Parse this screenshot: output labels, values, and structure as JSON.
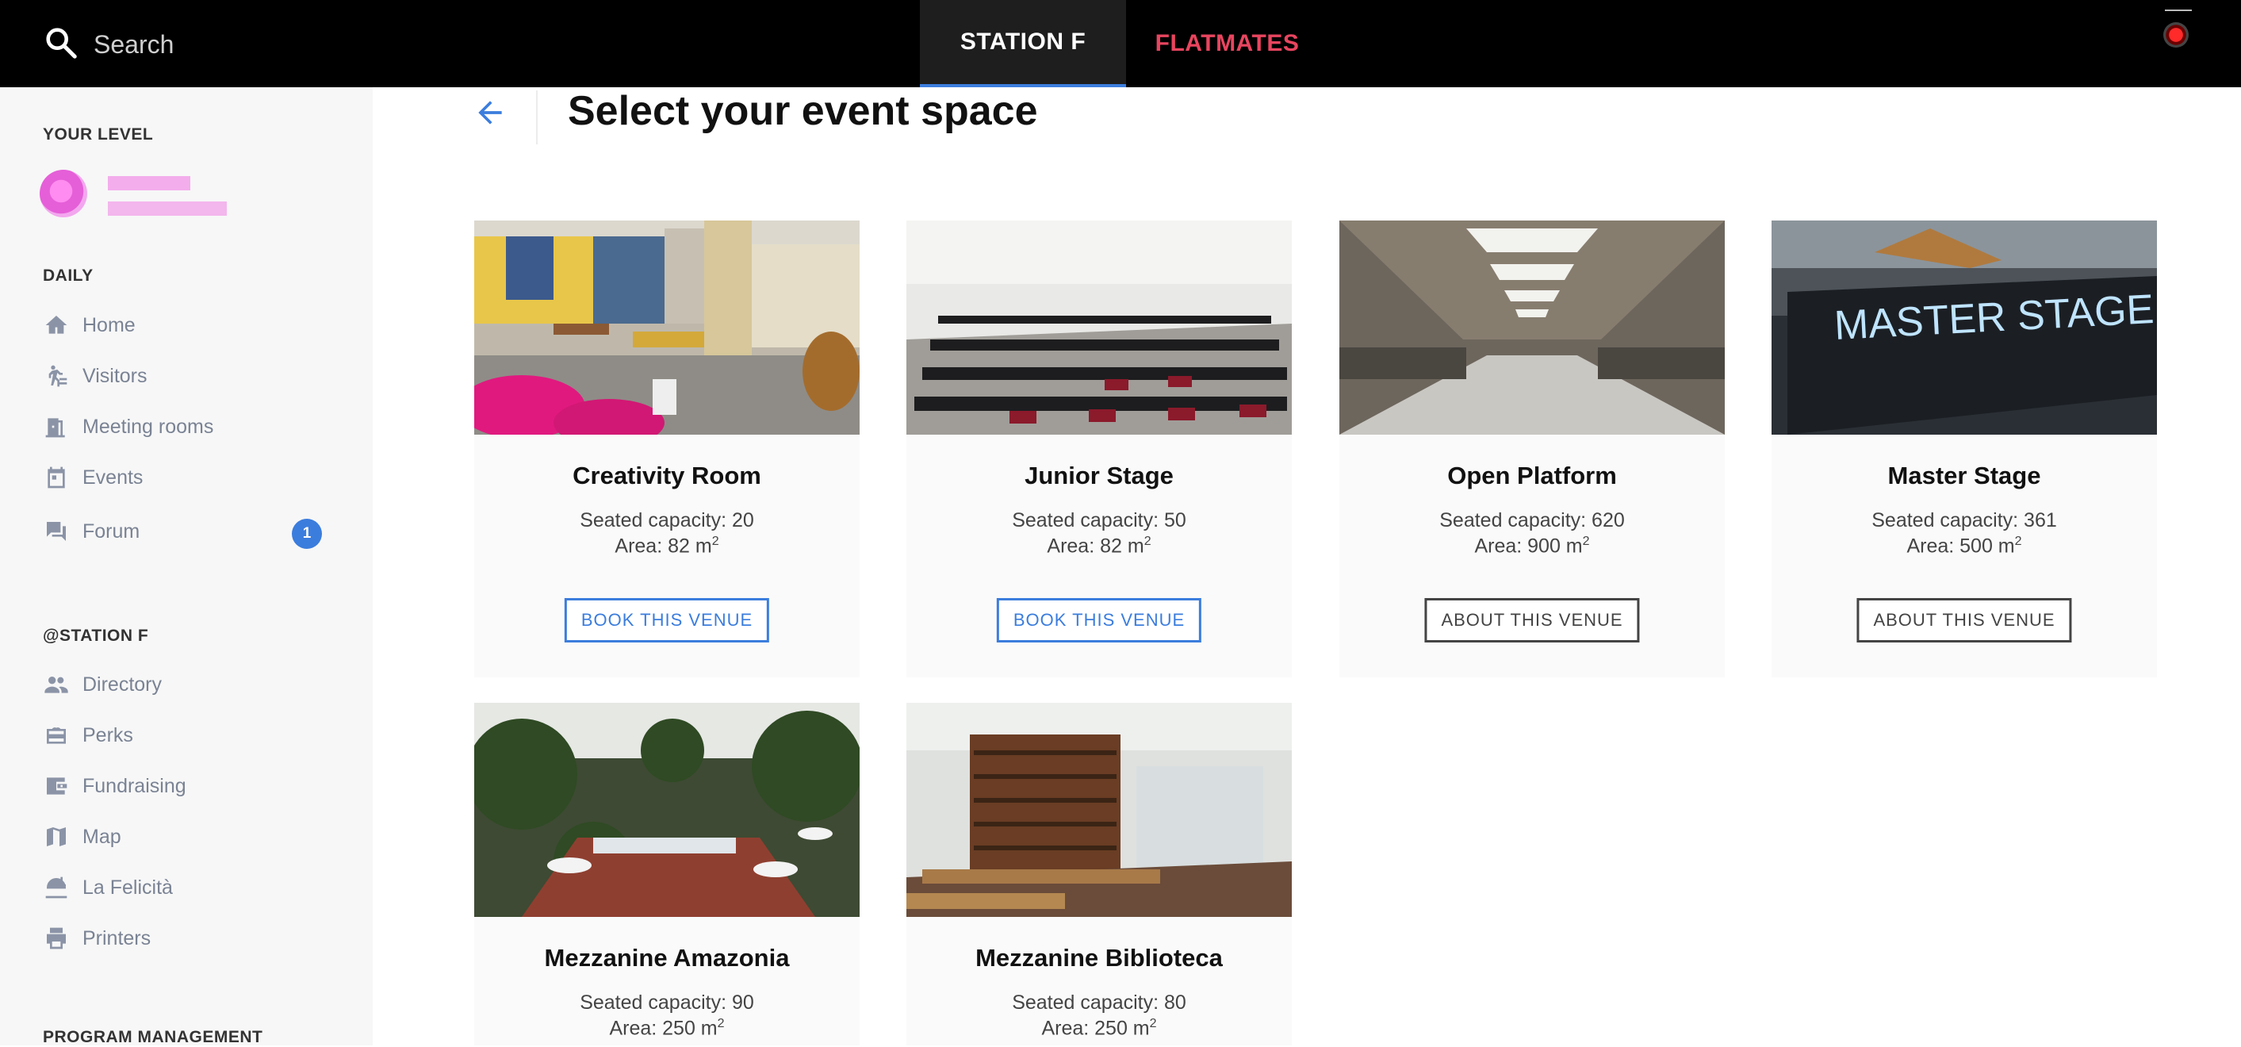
{
  "topbar": {
    "search_placeholder": "Search",
    "tabs": [
      {
        "label": "STATION F",
        "active": true
      },
      {
        "label": "FLATMATES",
        "active": false
      }
    ]
  },
  "sidebar": {
    "level_title": "YOUR LEVEL",
    "daily_title": "DAILY",
    "daily_items": [
      {
        "label": "Home",
        "icon": "home-icon"
      },
      {
        "label": "Visitors",
        "icon": "walking-person-icon"
      },
      {
        "label": "Meeting rooms",
        "icon": "meeting-room-icon"
      },
      {
        "label": "Events",
        "icon": "calendar-icon"
      },
      {
        "label": "Forum",
        "icon": "forum-icon",
        "badge": "1"
      }
    ],
    "station_title": "@STATION F",
    "station_items": [
      {
        "label": "Directory",
        "icon": "people-icon"
      },
      {
        "label": "Perks",
        "icon": "gift-card-icon"
      },
      {
        "label": "Fundraising",
        "icon": "wallet-icon"
      },
      {
        "label": "Map",
        "icon": "map-icon"
      },
      {
        "label": "La Felicità",
        "icon": "restaurant-icon"
      },
      {
        "label": "Printers",
        "icon": "printer-icon"
      }
    ],
    "program_title": "PROGRAM MANAGEMENT"
  },
  "main": {
    "title": "Select your event space",
    "venues": [
      {
        "name": "Creativity Room",
        "capacity": "Seated capacity: 20",
        "area": "Area: 82 m",
        "button": "BOOK THIS VENUE"
      },
      {
        "name": "Junior Stage",
        "capacity": "Seated capacity: 50",
        "area": "Area: 82 m",
        "button": "BOOK THIS VENUE"
      },
      {
        "name": "Open Platform",
        "capacity": "Seated capacity: 620",
        "area": "Area: 900 m",
        "button": "ABOUT THIS VENUE"
      },
      {
        "name": "Master Stage",
        "capacity": "Seated capacity: 361",
        "area": "Area: 500 m",
        "button": "ABOUT THIS VENUE",
        "sign_text": "MASTER STAGE"
      },
      {
        "name": "Mezzanine Amazonia",
        "capacity": "Seated capacity: 90",
        "area": "Area: 250 m"
      },
      {
        "name": "Mezzanine Biblioteca",
        "capacity": "Seated capacity: 80",
        "area": "Area: 250 m"
      }
    ],
    "area_exponent": "2"
  },
  "colors": {
    "accent": "#3b7ddd",
    "flatmates": "#e8455f",
    "topbar": "#000000"
  }
}
